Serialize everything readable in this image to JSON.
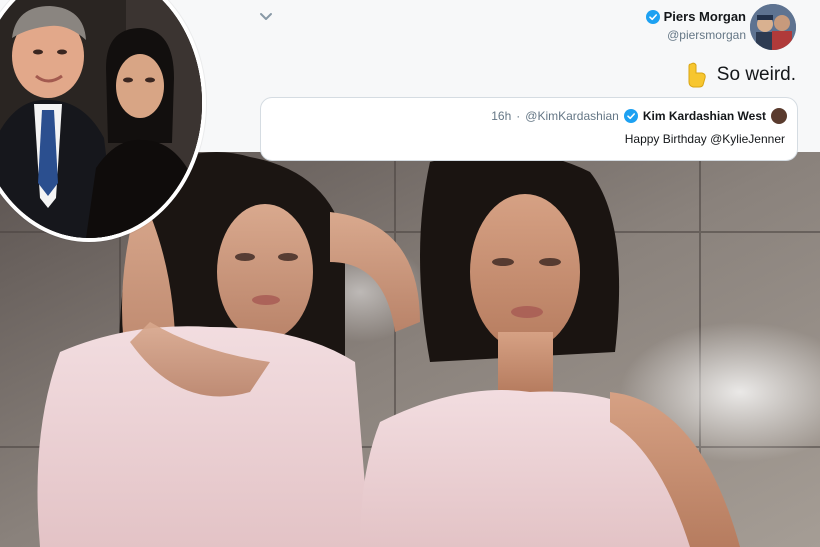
{
  "tweet": {
    "author_name": "Piers Morgan",
    "author_handle": "@piersmorgan",
    "text": "So weird.",
    "emoji_icon": "pointing-finger-emoji",
    "menu_icon": "chevron-down-icon"
  },
  "quoted_tweet": {
    "author_name": "Kim Kardashian West",
    "author_handle": "@KimKardashian",
    "separator": "·",
    "age": "16h",
    "text": "Happy Birthday @KylieJenner"
  },
  "colors": {
    "verified_blue": "#1da1f2",
    "text_primary": "#14171a",
    "text_secondary": "#657786",
    "card_border": "#d5dce2"
  }
}
